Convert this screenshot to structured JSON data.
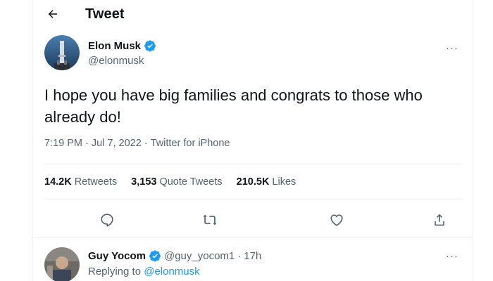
{
  "header": {
    "title": "Tweet"
  },
  "tweet": {
    "author_name": "Elon Musk",
    "author_handle": "@elonmusk",
    "more": "···",
    "text": "I hope you have big families and congrats to those who already do!",
    "time": "7:19 PM",
    "sep1": "·",
    "date": "Jul 7, 2022",
    "sep2": "·",
    "source": "Twitter for iPhone"
  },
  "stats": {
    "retweets_num": "14.2K",
    "retweets_label": "Retweets",
    "quotes_num": "3,153",
    "quotes_label": "Quote Tweets",
    "likes_num": "210.5K",
    "likes_label": "Likes"
  },
  "actions": [
    "reply-icon",
    "retweet-icon",
    "like-icon",
    "share-icon"
  ],
  "reply": {
    "name": "Guy Yocom",
    "handle": "@guy_yocom1",
    "dot": "·",
    "time": "17h",
    "more": "···",
    "replying_prefix": "Replying to",
    "replying_to": "@elonmusk"
  },
  "colors": {
    "accent": "#1d9bf0",
    "secondary_text": "#536471",
    "divider": "#eff3f4"
  }
}
